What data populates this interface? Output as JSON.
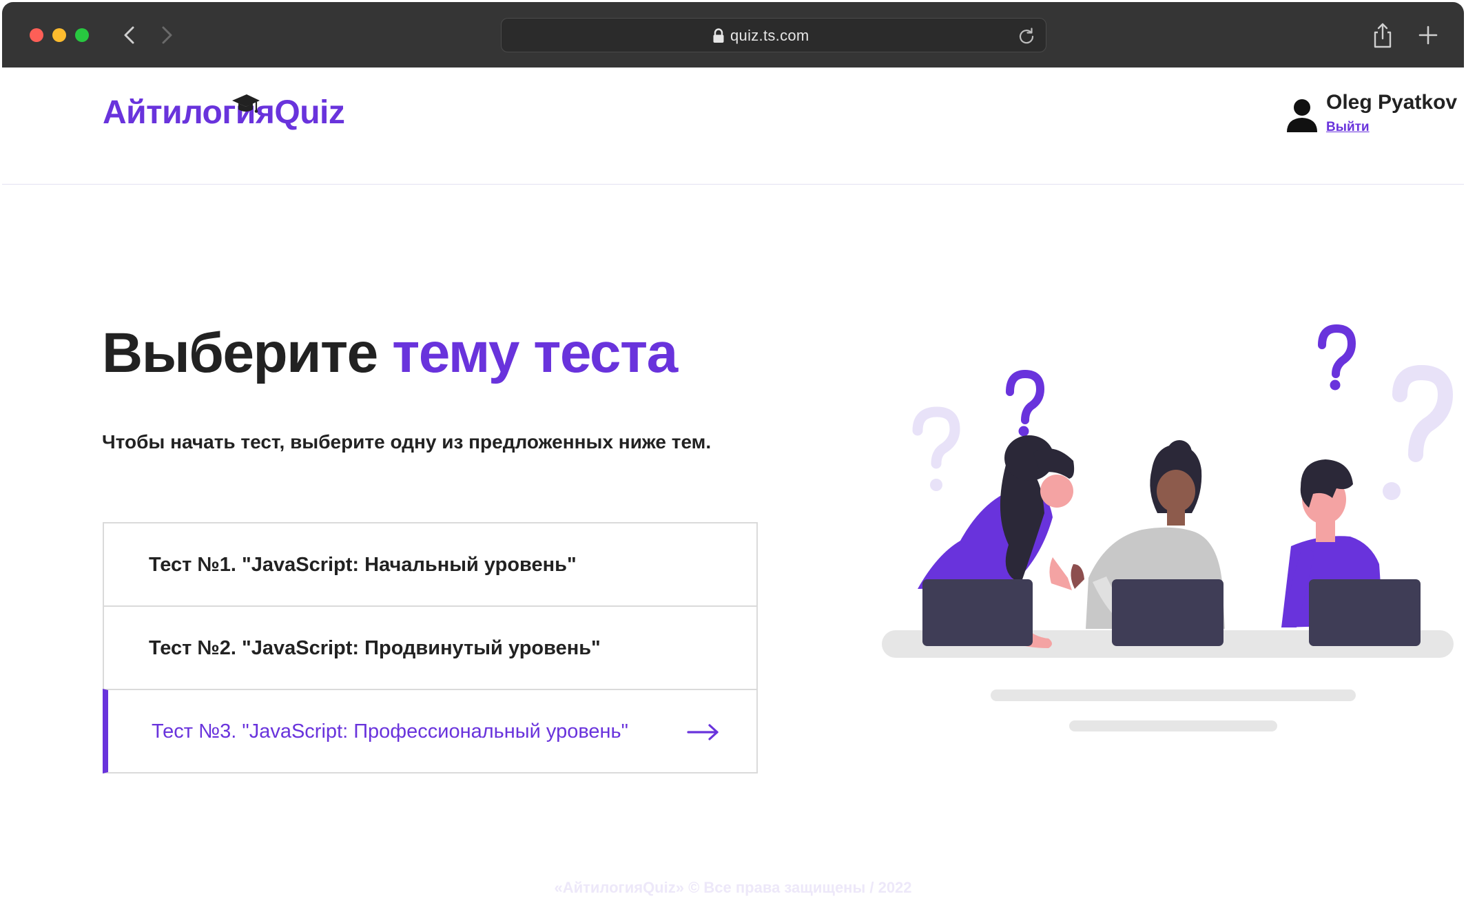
{
  "browser": {
    "url": "quiz.ts.com"
  },
  "header": {
    "logo": "АйтилогияQuiz",
    "user_name": "Oleg Pyatkov",
    "logout_label": "Выйти"
  },
  "main": {
    "title_part1": "Выберите",
    "title_part2": "тему теста",
    "subtitle": "Чтобы начать тест, выберите одну из предложенных ниже тем.",
    "tests": [
      {
        "label": "Тест №1. \"JavaScript: Начальный уровень\""
      },
      {
        "label": "Тест №2. \"JavaScript: Продвинутый уровень\""
      },
      {
        "label": "Тест №3. \"JavaScript: Профессиональный уровень\""
      }
    ]
  },
  "footer": {
    "text": "«АйтилогияQuiz» © Все права защищены / 2022"
  },
  "colors": {
    "brand": "#6933dc",
    "text": "#222222",
    "chrome": "#353535"
  }
}
